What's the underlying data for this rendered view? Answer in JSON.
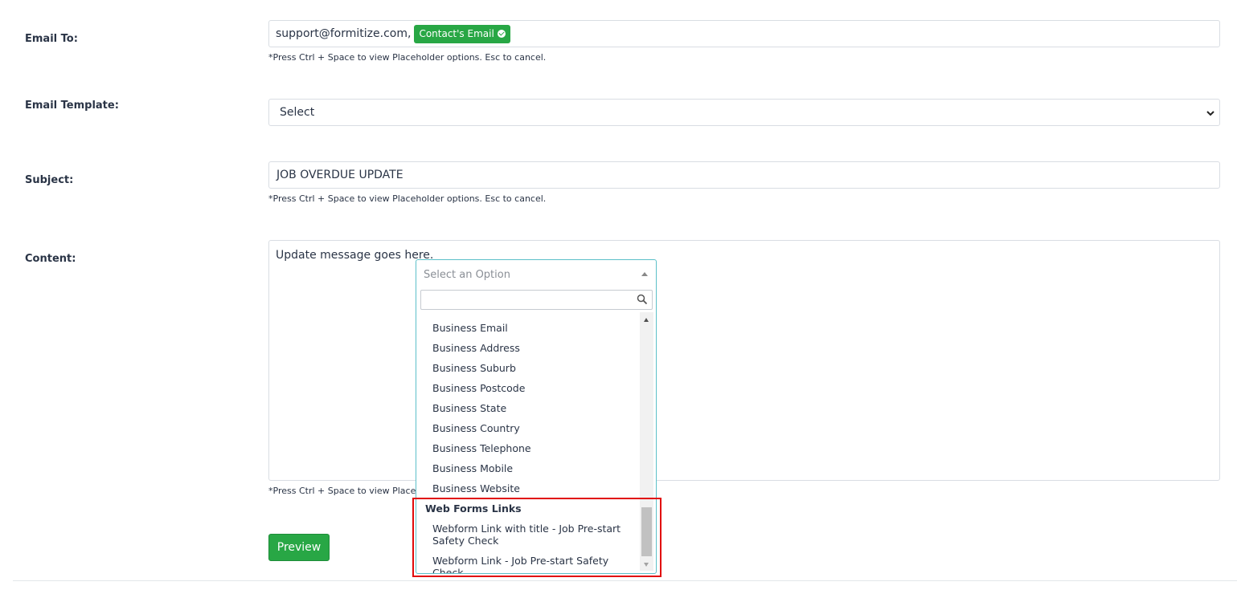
{
  "labels": {
    "email_to": "Email To:",
    "email_template": "Email Template:",
    "subject": "Subject:",
    "content": "Content:"
  },
  "email_to": {
    "value": "support@formitize.com,",
    "chip": "Contact's Email",
    "hint": "*Press Ctrl + Space to view Placeholder options. Esc to cancel."
  },
  "email_template": {
    "selected": "Select"
  },
  "subject": {
    "value": "JOB OVERDUE UPDATE",
    "hint": "*Press Ctrl + Space to view Placeholder options. Esc to cancel."
  },
  "content": {
    "value": "Update message goes here.",
    "hint_visible": "*Press Ctrl + Space to view Placeho"
  },
  "dropdown": {
    "placeholder": "Select an Option",
    "search_value": "",
    "options": [
      "Business Email",
      "Business Address",
      "Business Suburb",
      "Business Postcode",
      "Business State",
      "Business Country",
      "Business Telephone",
      "Business Mobile",
      "Business Website"
    ],
    "group": {
      "label": "Web Forms Links",
      "options": [
        "Webform Link with title - Job Pre-start Safety Check",
        "Webform Link - Job Pre-start Safety Check"
      ]
    }
  },
  "preview_button": "Preview",
  "colors": {
    "accent_green": "#28a745",
    "dropdown_border": "#5cc0c9",
    "highlight_red": "#e10a0a"
  }
}
